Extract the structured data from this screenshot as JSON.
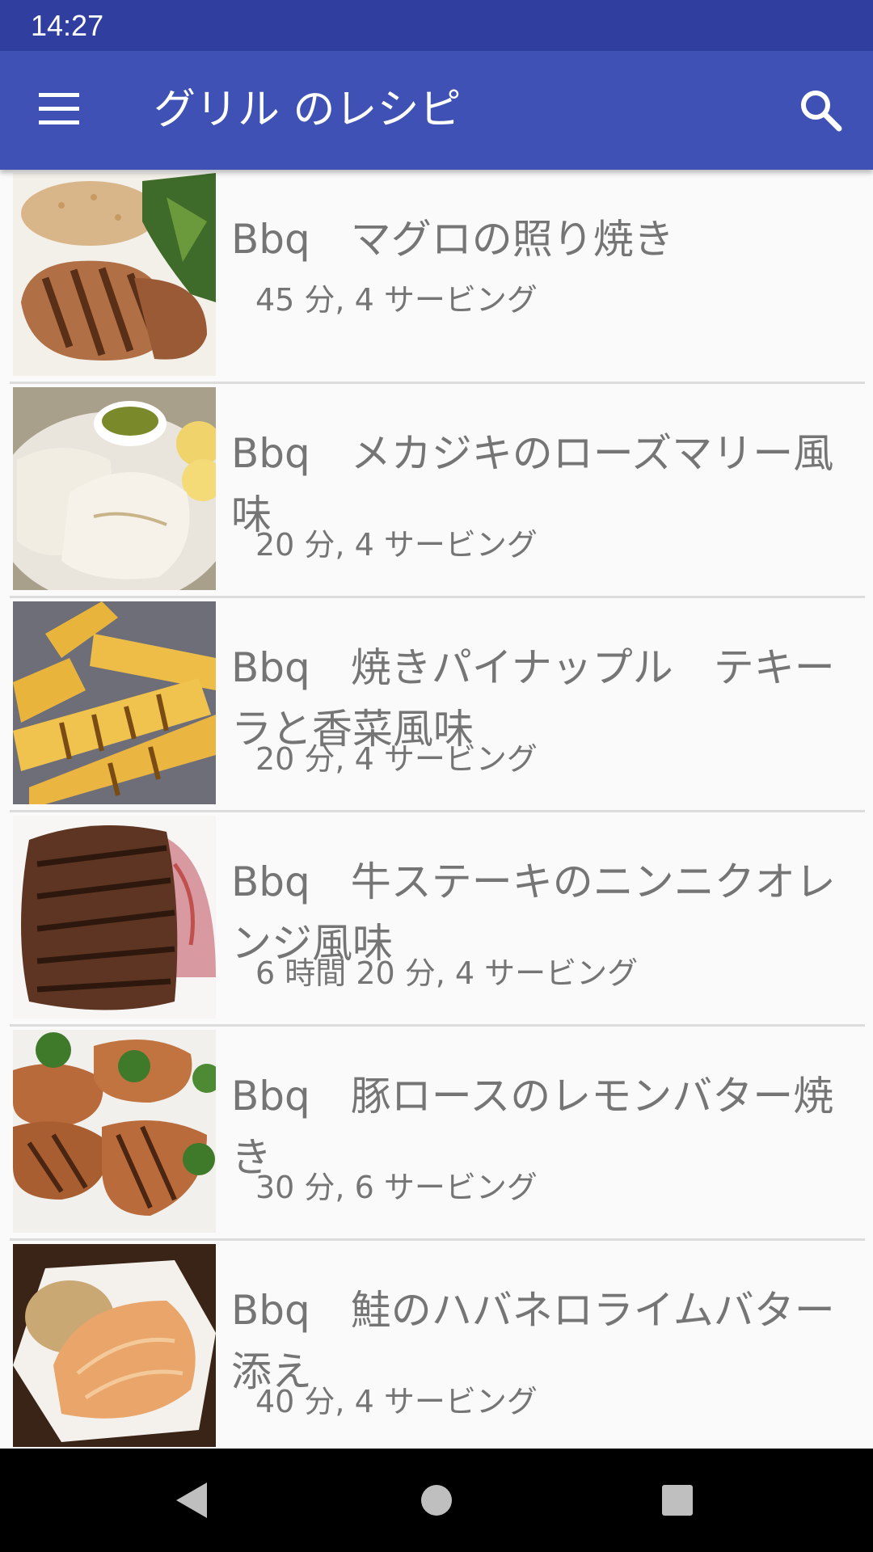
{
  "status_bar": {
    "time": "14:27"
  },
  "app_bar": {
    "title": "グリル のレシピ",
    "menu_icon": "hamburger-menu-icon",
    "search_icon": "search-icon",
    "color": "#3f51b5",
    "status_color": "#303f9f"
  },
  "recipes": [
    {
      "title": "Bbq　マグロの照り焼き",
      "meta": "45 分, 4 サービング",
      "image": "grilled-tuna-photo"
    },
    {
      "title": "Bbq　メカジキのローズマリー風味",
      "meta": "20 分, 4 サービング",
      "image": "grilled-swordfish-photo"
    },
    {
      "title": "Bbq　焼きパイナップル　テキーラと香菜風味",
      "meta": "20 分, 4 サービング",
      "image": "grilled-pineapple-photo"
    },
    {
      "title": "Bbq　牛ステーキのニンニクオレンジ風味",
      "meta": "6 時間 20 分, 4 サービング",
      "image": "beef-steak-photo"
    },
    {
      "title": "Bbq　豚ロースのレモンバター焼き",
      "meta": "30 分, 6 サービング",
      "image": "grilled-pork-photo"
    },
    {
      "title": "Bbq　鮭のハバネロライムバター添え",
      "meta": "40 分, 4 サービング",
      "image": "salmon-photo"
    }
  ],
  "nav_bar": {
    "back_icon": "back-triangle-icon",
    "home_icon": "home-circle-icon",
    "recents_icon": "recents-square-icon"
  }
}
